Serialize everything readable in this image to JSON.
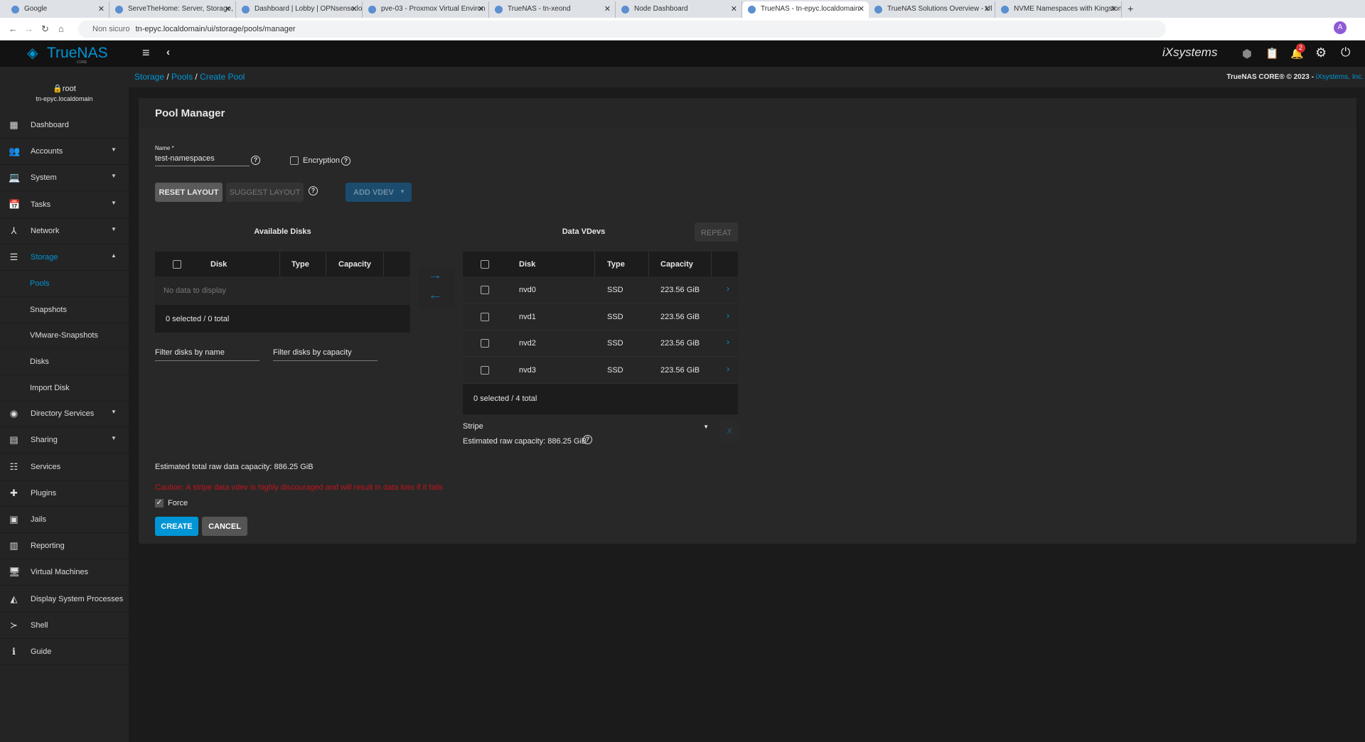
{
  "browser": {
    "tabs": [
      {
        "title": "Google"
      },
      {
        "title": "ServeTheHome: Server, Storage,"
      },
      {
        "title": "Dashboard | Lobby | OPNsense.lo"
      },
      {
        "title": "pve-03 - Proxmox Virtual Environ"
      },
      {
        "title": "TrueNAS - tn-xeond"
      },
      {
        "title": "Node Dashboard"
      },
      {
        "title": "TrueNAS - tn-epyc.localdomain"
      },
      {
        "title": "TrueNAS Solutions Overview - Ul"
      },
      {
        "title": "NVME Namespaces with Kingston"
      }
    ],
    "active_tab": 6,
    "security": "Non sicuro",
    "url": "tn-epyc.localdomain/ui/storage/pools/manager",
    "new_tab": "+"
  },
  "header": {
    "logo": "TrueNAS",
    "logo_sub": "CORE",
    "vendor": "iXsystems",
    "notification_count": "2"
  },
  "breadcrumb": [
    "Storage",
    "Pools",
    "Create Pool"
  ],
  "copyright": {
    "text": "TrueNAS CORE® © 2023 - ",
    "link": "iXsystems, Inc."
  },
  "user": {
    "name": "root",
    "host": "tn-epyc.localdomain"
  },
  "sidebar": {
    "items": [
      {
        "label": "Dashboard",
        "icon": "dashboard-icon",
        "glyph": "▦"
      },
      {
        "label": "Accounts",
        "icon": "accounts-icon",
        "glyph": "👥",
        "caret": "▼"
      },
      {
        "label": "System",
        "icon": "laptop-icon",
        "glyph": "💻",
        "caret": "▼"
      },
      {
        "label": "Tasks",
        "icon": "calendar-icon",
        "glyph": "📅",
        "caret": "▼"
      },
      {
        "label": "Network",
        "icon": "network-icon",
        "glyph": "⅄",
        "caret": "▼"
      },
      {
        "label": "Storage",
        "icon": "storage-icon",
        "glyph": "☰",
        "caret": "▲",
        "active": true
      },
      {
        "label": "Pools",
        "sub": true,
        "active": true
      },
      {
        "label": "Snapshots",
        "sub": true
      },
      {
        "label": "VMware-Snapshots",
        "sub": true
      },
      {
        "label": "Disks",
        "sub": true
      },
      {
        "label": "Import Disk",
        "sub": true
      },
      {
        "label": "Directory Services",
        "icon": "directory-icon",
        "glyph": "◉",
        "caret": "▼"
      },
      {
        "label": "Sharing",
        "icon": "sharing-icon",
        "glyph": "▤",
        "caret": "▼"
      },
      {
        "label": "Services",
        "icon": "services-icon",
        "glyph": "☷"
      },
      {
        "label": "Plugins",
        "icon": "plugins-icon",
        "glyph": "✚"
      },
      {
        "label": "Jails",
        "icon": "jails-icon",
        "glyph": "▣"
      },
      {
        "label": "Reporting",
        "icon": "reporting-icon",
        "glyph": "▥"
      },
      {
        "label": "Virtual Machines",
        "icon": "vm-icon",
        "glyph": "🖥"
      },
      {
        "label": "Display System Processes",
        "icon": "processes-icon",
        "glyph": "◭"
      },
      {
        "label": "Shell",
        "icon": "shell-icon",
        "glyph": "≻"
      },
      {
        "label": "Guide",
        "icon": "info-icon",
        "glyph": "ℹ"
      }
    ]
  },
  "pool": {
    "title": "Pool Manager",
    "name_label": "Name *",
    "name_value": "test-namespaces",
    "encryption": "Encryption",
    "reset": "RESET LAYOUT",
    "suggest": "SUGGEST LAYOUT",
    "add_vdev": "ADD VDEV",
    "available": {
      "title": "Available Disks",
      "columns": [
        "Disk",
        "Type",
        "Capacity"
      ],
      "empty": "No data to display",
      "footer": "0 selected / 0 total",
      "filter_name": "Filter disks by name",
      "filter_capacity": "Filter disks by capacity"
    },
    "vdevs": {
      "title": "Data VDevs",
      "repeat": "REPEAT",
      "columns": [
        "Disk",
        "Type",
        "Capacity"
      ],
      "rows": [
        {
          "disk": "nvd0",
          "type": "SSD",
          "capacity": "223.56 GiB"
        },
        {
          "disk": "nvd1",
          "type": "SSD",
          "capacity": "223.56 GiB"
        },
        {
          "disk": "nvd2",
          "type": "SSD",
          "capacity": "223.56 GiB"
        },
        {
          "disk": "nvd3",
          "type": "SSD",
          "capacity": "223.56 GiB"
        }
      ],
      "footer": "0 selected / 4 total",
      "layout": "Stripe",
      "remove": "X",
      "raw": "Estimated raw capacity: 886.25 GiB"
    },
    "total": "Estimated total raw data capacity: 886.25 GiB",
    "caution": "Caution: A stripe data vdev is highly discouraged and will result in data loss if it fails",
    "force": "Force",
    "force_checked": true,
    "create": "CREATE",
    "cancel": "CANCEL"
  },
  "colors": {
    "accent": "#0095d5",
    "danger": "#c3141c"
  }
}
